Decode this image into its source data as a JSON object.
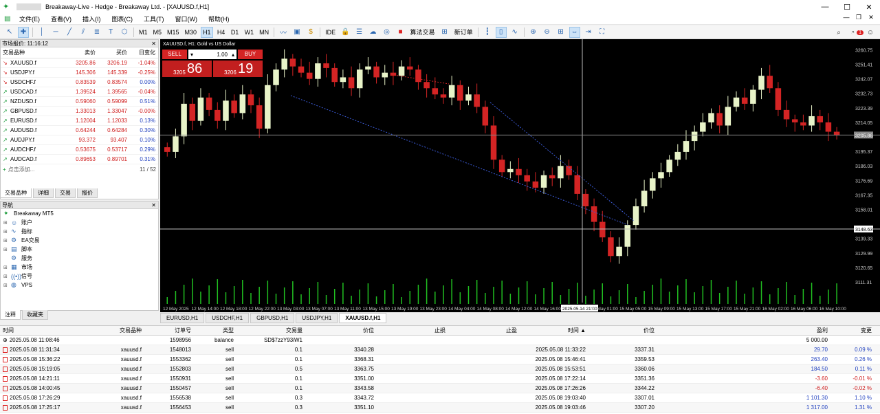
{
  "window": {
    "title": "Breakaway-Live - Hedge - Breakaway Ltd. - [XAUUSD.f,H1]",
    "controls": [
      "—",
      "☐",
      "✕"
    ]
  },
  "menu": [
    "文件(E)",
    "查看(V)",
    "插入(I)",
    "图表(C)",
    "工具(T)",
    "窗口(W)",
    "帮助(H)"
  ],
  "toolbar": {
    "timeframes": [
      "M1",
      "M5",
      "M15",
      "M30",
      "H1",
      "H4",
      "D1",
      "W1",
      "MN"
    ],
    "active_tf": "H1",
    "ide": "IDE",
    "algo": "算法交易",
    "new_order": "新订单",
    "notify_count": "1"
  },
  "market_watch": {
    "title": "市场报价: 11:16:12",
    "headers": [
      "交易品种",
      "卖价",
      "买价",
      "日变化"
    ],
    "rows": [
      {
        "sym": "XAUUSD.f",
        "bid": "3205.86",
        "ask": "3206.19",
        "chg": "-1.04%",
        "dir": "down"
      },
      {
        "sym": "USDJPY.f",
        "bid": "145.306",
        "ask": "145.339",
        "chg": "-0.25%",
        "dir": "down"
      },
      {
        "sym": "USDCHF.f",
        "bid": "0.83539",
        "ask": "0.83574",
        "chg": "0.00%",
        "dir": "down"
      },
      {
        "sym": "USDCAD.f",
        "bid": "1.39524",
        "ask": "1.39565",
        "chg": "-0.04%",
        "dir": "up"
      },
      {
        "sym": "NZDUSD.f",
        "bid": "0.59060",
        "ask": "0.59099",
        "chg": "0.51%",
        "dir": "up"
      },
      {
        "sym": "GBPUSD.f",
        "bid": "1.33013",
        "ask": "1.33047",
        "chg": "-0.00%",
        "dir": "up"
      },
      {
        "sym": "EURUSD.f",
        "bid": "1.12004",
        "ask": "1.12033",
        "chg": "0.13%",
        "dir": "up"
      },
      {
        "sym": "AUDUSD.f",
        "bid": "0.64244",
        "ask": "0.64284",
        "chg": "0.30%",
        "dir": "up"
      },
      {
        "sym": "AUDJPY.f",
        "bid": "93.372",
        "ask": "93.407",
        "chg": "0.10%",
        "dir": "up"
      },
      {
        "sym": "AUDCHF.f",
        "bid": "0.53675",
        "ask": "0.53717",
        "chg": "0.29%",
        "dir": "up"
      },
      {
        "sym": "AUDCAD.f",
        "bid": "0.89653",
        "ask": "0.89701",
        "chg": "0.31%",
        "dir": "up"
      }
    ],
    "add_label": "点击添加...",
    "count": "11 / 52",
    "tabs": [
      "交易品种",
      "详细",
      "交易",
      "报价"
    ]
  },
  "navigator": {
    "title": "导航",
    "root": "Breakaway MT5",
    "items": [
      "账户",
      "指标",
      "EA交易",
      "脚本",
      "服务",
      "市场",
      "信号",
      "VPS"
    ],
    "tabs": [
      "注释",
      "收藏夹"
    ]
  },
  "chart": {
    "title": "XAUUSD.f, H1:  Gold vs US Dollar",
    "sell": "SELL",
    "buy": "BUY",
    "lot": "1.00",
    "sell_small": "3205",
    "sell_big": "86",
    "buy_small": "3206",
    "buy_big": "19",
    "y_ticks": [
      "3260.75",
      "3251.41",
      "3242.07",
      "3232.73",
      "3223.39",
      "3214.05",
      "3195.37",
      "3186.03",
      "3176.69",
      "3167.35",
      "3158.01",
      "3139.33",
      "3129.99",
      "3120.65",
      "3111.31"
    ],
    "price_tag": "3205.86",
    "cross_tag": "3148.63",
    "x_ticks": [
      "12 May 2025",
      "12 May 14:00",
      "12 May 18:00",
      "12 May 22:00",
      "13 May 03:00",
      "13 May 07:00",
      "13 May 11:00",
      "13 May 15:00",
      "13 May 19:00",
      "13 May 23:00",
      "14 May 04:00",
      "14 May 08:00",
      "14 May 12:00",
      "14 May 16:00",
      "2025.05.14 21:00",
      "15 May 01:00",
      "15 May 05:00",
      "15 May 09:00",
      "15 May 13:00",
      "15 May 17:00",
      "15 May 21:00",
      "16 May 02:00",
      "16 May 06:00",
      "16 May 10:00"
    ],
    "tabs": [
      "EURUSD,H1",
      "USDCHF,H1",
      "GBPUSD,H1",
      "USDJPY,H1",
      "XAUUSD.f,H1"
    ],
    "active_tab": "XAUUSD.f,H1"
  },
  "history": {
    "headers": [
      "时间",
      "交易品种",
      "订单号",
      "类型",
      "交易量",
      "价位",
      "止损",
      "止盈",
      "时间 ▲",
      "价位",
      "盈利",
      "变更"
    ],
    "rows": [
      [
        "2025.05.08 11:08:46",
        "",
        "1598956",
        "balance",
        "SD$7zzY93iW1",
        "",
        "",
        "",
        "",
        "",
        "5 000.00",
        ""
      ],
      [
        "2025.05.08 11:31:34",
        "xauusd.f",
        "1548013",
        "sell",
        "0.1",
        "3340.28",
        "",
        "",
        "2025.05.08 11:33:22",
        "3337.31",
        "29.70",
        "0.09 %"
      ],
      [
        "2025.05.08 15:36:22",
        "xauusd.f",
        "1553362",
        "sell",
        "0.1",
        "3368.31",
        "",
        "",
        "2025.05.08 15:46:41",
        "3359.53",
        "263.40",
        "0.26 %"
      ],
      [
        "2025.05.08 15:19:05",
        "xauusd.f",
        "1552803",
        "sell",
        "0.5",
        "3363.75",
        "",
        "",
        "2025.05.08 15:53:51",
        "3360.06",
        "184.50",
        "0.11 %"
      ],
      [
        "2025.05.08 14:21:11",
        "xauusd.f",
        "1550931",
        "sell",
        "0.1",
        "3351.00",
        "",
        "",
        "2025.05.08 17:22:14",
        "3351.36",
        "-3.60",
        "-0.01 %"
      ],
      [
        "2025.05.08 14:00:45",
        "xauusd.f",
        "1550457",
        "sell",
        "0.1",
        "3343.58",
        "",
        "",
        "2025.05.08 17:26:26",
        "3344.22",
        "-6.40",
        "-0.02 %"
      ],
      [
        "2025.05.08 17:26:29",
        "xauusd.f",
        "1556538",
        "sell",
        "0.3",
        "3343.72",
        "",
        "",
        "2025.05.08 19:03:40",
        "3307.01",
        "1 101.30",
        "1.10 %"
      ],
      [
        "2025.05.08 17:25:17",
        "xauusd.f",
        "1556453",
        "sell",
        "0.3",
        "3351.10",
        "",
        "",
        "2025.05.08 19:03:46",
        "3307.20",
        "1 317.00",
        "1.31 %"
      ]
    ]
  },
  "colors": {
    "up": "#e8f3c8",
    "down": "#d42424",
    "bg": "#000000"
  }
}
